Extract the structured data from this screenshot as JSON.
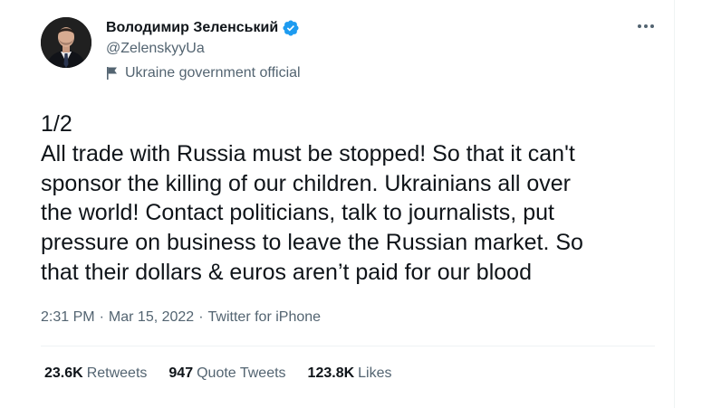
{
  "author": {
    "display_name": "Володимир Зеленський",
    "handle": "@ZelenskyyUa",
    "label": "Ukraine government official",
    "verified_color": "#1d9bf0"
  },
  "tweet": {
    "lines": [
      "1/2",
      "All trade with Russia must be stopped! So that it can't",
      "sponsor the killing of our children. Ukrainians all over",
      "the world! Contact politicians, talk to journalists, put",
      "pressure on business to leave the Russian market. So",
      "that their dollars & euros aren’t paid for our blood"
    ]
  },
  "meta": {
    "time": "2:31 PM",
    "separator": "·",
    "date": "Mar 15, 2022",
    "source": "Twitter for iPhone"
  },
  "stats": {
    "retweets_count": "23.6K",
    "retweets_label": "Retweets",
    "quotes_count": "947",
    "quotes_label": "Quote Tweets",
    "likes_count": "123.8K",
    "likes_label": "Likes"
  },
  "icons": {
    "more": "more-horizontal-icon",
    "verified": "verified-badge-icon",
    "flag": "flag-icon"
  }
}
